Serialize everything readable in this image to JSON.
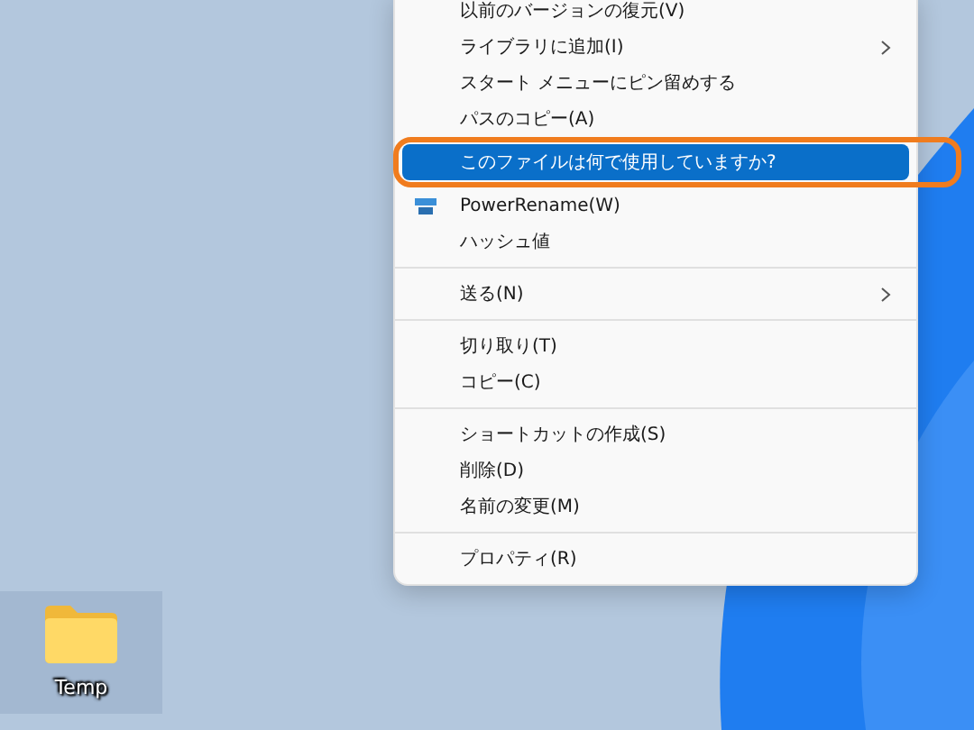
{
  "desktop_icons": [
    {
      "label": "Temp",
      "selected": true
    }
  ],
  "context_menu": {
    "items": [
      {
        "kind": "item",
        "label": "以前のバージョンの復元(V)",
        "selected": false,
        "submenu": false
      },
      {
        "kind": "item",
        "label": "ライブラリに追加(I)",
        "selected": false,
        "submenu": true
      },
      {
        "kind": "item",
        "label": "スタート メニューにピン留めする",
        "selected": false,
        "submenu": false
      },
      {
        "kind": "item",
        "label": "パスのコピー(A)",
        "selected": false,
        "submenu": false
      },
      {
        "kind": "item",
        "label": "このファイルは何で使用していますか?",
        "selected": true,
        "submenu": false
      },
      {
        "kind": "app_item",
        "label": "PowerRename(W)",
        "selected": false,
        "submenu": false
      },
      {
        "kind": "item",
        "label": "ハッシュ値",
        "selected": false,
        "submenu": false
      },
      {
        "kind": "separator"
      },
      {
        "kind": "item",
        "label": "送る(N)",
        "selected": false,
        "submenu": true
      },
      {
        "kind": "separator"
      },
      {
        "kind": "item",
        "label": "切り取り(T)",
        "selected": false,
        "submenu": false
      },
      {
        "kind": "item",
        "label": "コピー(C)",
        "selected": false,
        "submenu": false
      },
      {
        "kind": "separator"
      },
      {
        "kind": "item",
        "label": "ショートカットの作成(S)",
        "selected": false,
        "submenu": false
      },
      {
        "kind": "item",
        "label": "削除(D)",
        "selected": false,
        "submenu": false
      },
      {
        "kind": "item",
        "label": "名前の変更(M)",
        "selected": false,
        "submenu": false
      },
      {
        "kind": "separator"
      },
      {
        "kind": "item",
        "label": "プロパティ(R)",
        "selected": false,
        "submenu": false
      }
    ]
  }
}
